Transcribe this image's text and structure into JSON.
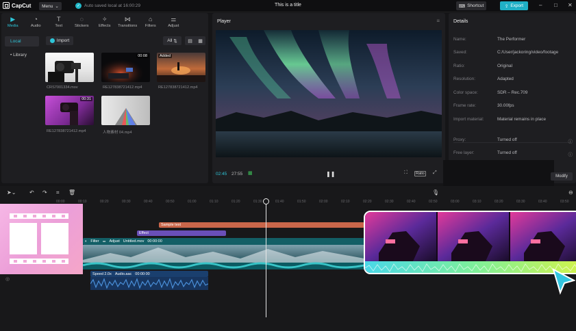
{
  "app": {
    "name": "CapCut",
    "menu_label": "Menu",
    "autosave_text": "Auto saved local at 16:00:29",
    "project_title": "This is a title",
    "shortcut_label": "Shortcut",
    "export_label": "Export",
    "window_controls": [
      "–",
      "□",
      "✕"
    ]
  },
  "toolbar": {
    "tabs": [
      {
        "label": "Media",
        "icon": "media-icon",
        "glyph": "▶"
      },
      {
        "label": "Audio",
        "icon": "audio-icon",
        "glyph": "◔"
      },
      {
        "label": "Text",
        "icon": "text-icon",
        "glyph": "T"
      },
      {
        "label": "Stickers",
        "icon": "stickers-icon",
        "glyph": "◌"
      },
      {
        "label": "Effects",
        "icon": "effects-icon",
        "glyph": "✧"
      },
      {
        "label": "Transitions",
        "icon": "transitions-icon",
        "glyph": "⋈"
      },
      {
        "label": "Filters",
        "icon": "filters-icon",
        "glyph": "⌂"
      },
      {
        "label": "Adjust",
        "icon": "adjust-icon",
        "glyph": "⚌"
      }
    ],
    "active_tab": "Media"
  },
  "media": {
    "sidebar": [
      {
        "label": "Local"
      },
      {
        "label": "• Library"
      }
    ],
    "import_label": "Import",
    "filter_label": "All",
    "items": [
      {
        "name": "CRS7001334.mov",
        "badge": ""
      },
      {
        "name": "RE127838721412.mp4",
        "badge": "00:08"
      },
      {
        "name": "RE127838721412.mp4",
        "badge": "Added"
      },
      {
        "name": "RE127838721412.mp4",
        "badge": "00:31"
      },
      {
        "name": "人物素材 04.mp4",
        "badge": ""
      }
    ]
  },
  "player": {
    "title": "Player",
    "current_time": "02:45",
    "total_time": "27:55",
    "ratio_label": "Ratio"
  },
  "details": {
    "title": "Details",
    "rows": [
      {
        "key": "Name:",
        "value": "The Performer"
      },
      {
        "key": "Saved:",
        "value": "C:/User/jackoring/video/footage"
      },
      {
        "key": "Ratio:",
        "value": "Original"
      },
      {
        "key": "Resolution:",
        "value": "Adapted"
      },
      {
        "key": "Color space:",
        "value": "SDR – Rec.709"
      },
      {
        "key": "Frame rate:",
        "value": "30.00fps"
      },
      {
        "key": "Import material:",
        "value": "Material remains in place"
      }
    ],
    "rows2": [
      {
        "key": "Proxy:",
        "value": "Turned off"
      },
      {
        "key": "Free layer:",
        "value": "Turned off"
      }
    ],
    "modify_label": "Modify"
  },
  "timeline": {
    "ticks": [
      "00:00",
      "00:10",
      "00:20",
      "00:30",
      "00:40",
      "00:50",
      "01:00",
      "01:10",
      "01:20",
      "01:30",
      "01:40",
      "01:50",
      "02:00",
      "02:10",
      "02:20",
      "02:30",
      "02:40",
      "02:50",
      "03:00",
      "03:10",
      "03:20",
      "03:30",
      "03:40",
      "03:50"
    ],
    "text_clip": "Sample text",
    "effect_clip": "Effect",
    "video_clip": {
      "filter": "Filter",
      "adjust": "Adjust",
      "name": "Untitled.mov",
      "duration": "00:00:00"
    },
    "audio_clip": {
      "speed": "Speed 2.0x",
      "name": "Audio.aac",
      "duration": "00:00:00"
    }
  },
  "colors": {
    "accent": "#2ec5d8",
    "text_clip": "#c9664a",
    "effect_clip": "#6a4fb8",
    "video_track": "#135f66",
    "audio_track": "#1a3f6e"
  }
}
